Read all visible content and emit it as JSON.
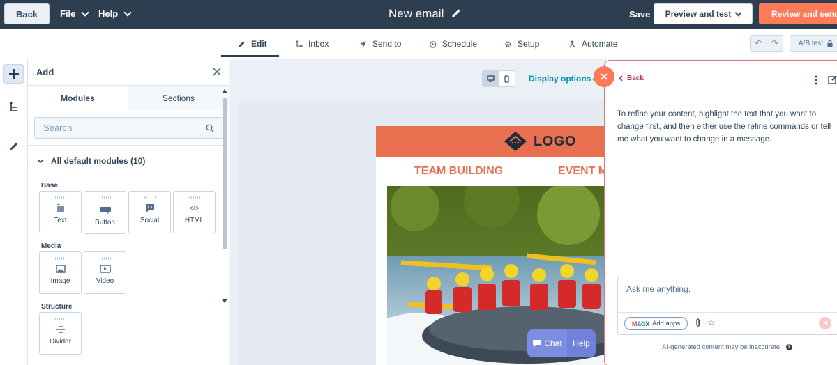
{
  "topbar": {
    "back_label": "Back",
    "file_label": "File",
    "help_label": "Help",
    "title": "New email",
    "save_label": "Save",
    "preview_label": "Preview and test",
    "review_label": "Review and send"
  },
  "tabs": [
    {
      "label": "Edit",
      "icon": "pencil-icon",
      "active": true
    },
    {
      "label": "Inbox",
      "icon": "inbox-icon"
    },
    {
      "label": "Send to",
      "icon": "send-icon"
    },
    {
      "label": "Schedule",
      "icon": "clock-icon"
    },
    {
      "label": "Setup",
      "icon": "gear-icon"
    },
    {
      "label": "Automate",
      "icon": "automate-icon"
    }
  ],
  "toolbar_right": {
    "abtest_label": "A/B test"
  },
  "add_panel": {
    "title": "Add",
    "tab_modules": "Modules",
    "tab_sections": "Sections",
    "search_placeholder": "Search",
    "group_title": "All default modules (10)",
    "sections": {
      "base": "Base",
      "media": "Media",
      "structure": "Structure"
    },
    "modules": {
      "text": "Text",
      "button": "Button",
      "social": "Social",
      "html": "HTML",
      "image": "Image",
      "video": "Video",
      "divider": "Divider"
    }
  },
  "canvas": {
    "display_options": "Display options",
    "email": {
      "logo_text": "LOGO",
      "nav_left": "TEAM BUILDING",
      "nav_right": "EVENT M"
    }
  },
  "chat_widget": {
    "chat_label": "Chat",
    "help_label": "Help"
  },
  "ai_panel": {
    "back_label": "Back",
    "message": "To refine your content, highlight the text that you want to change first, and then either use the refine commands or tell me what you want to change in a message.",
    "input_placeholder": "Ask me anything.",
    "add_apps_label": "Add apps",
    "disclaimer": "AI-generated content may be inaccurate."
  },
  "colors": {
    "topbar_bg": "#2d3e50",
    "accent_orange": "#ff7a59",
    "link_teal": "#0091ae",
    "email_header": "#e8704f",
    "ai_accent": "#b5275c"
  }
}
